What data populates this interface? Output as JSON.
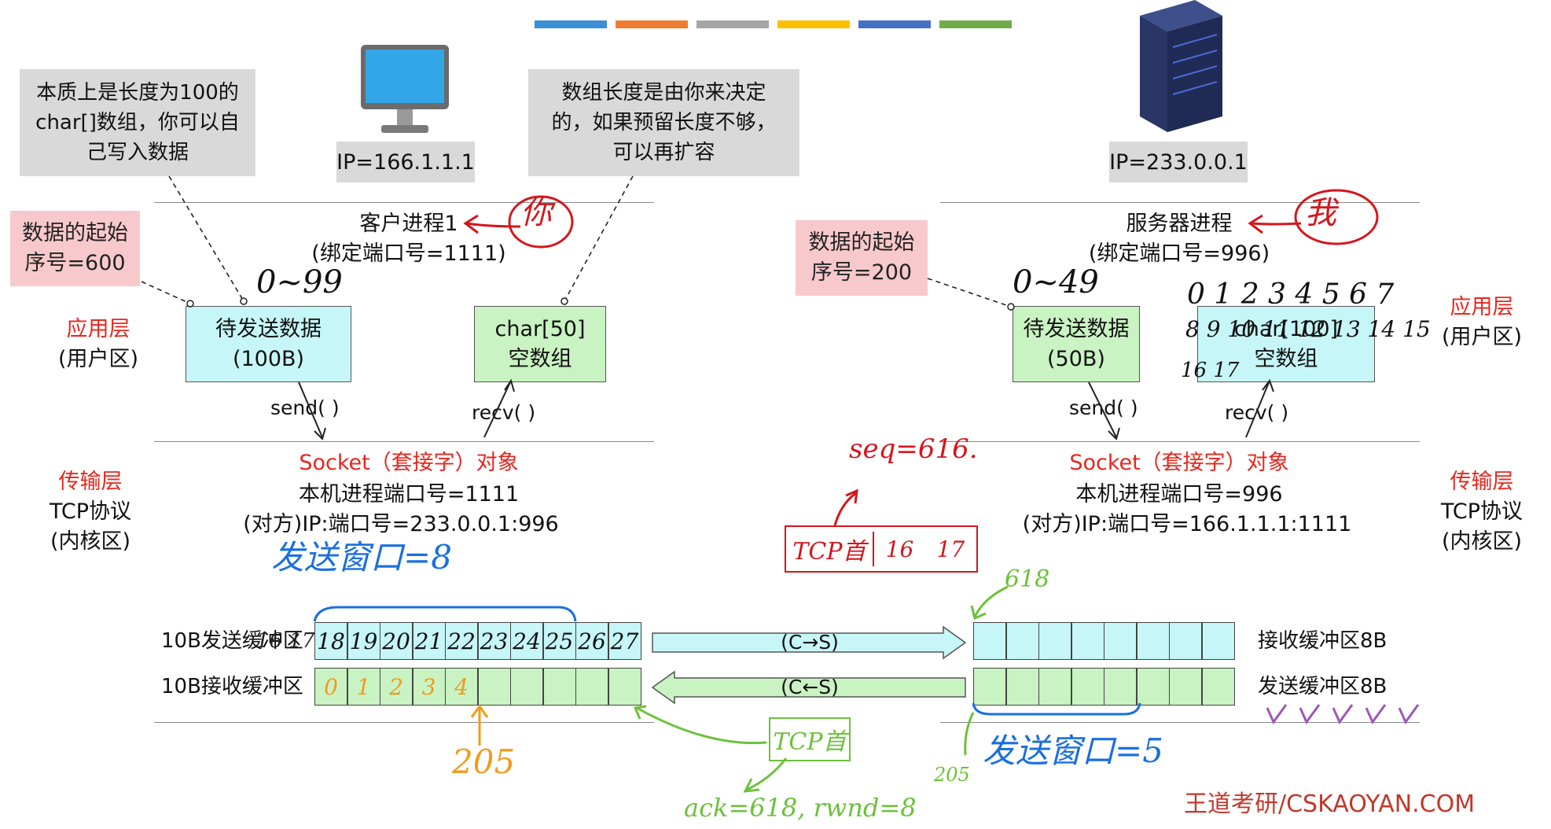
{
  "colors": {
    "red": "#e8261e",
    "blue": "#1a6fe0",
    "orange": "#f29b1e",
    "green": "#6cc23a",
    "cyan": "#c6f6f8",
    "lightgreen": "#c9f3c2",
    "pink": "#f8c9cc",
    "gray": "#d9d9d9"
  },
  "top_bar_colors": [
    "#3b8fd4",
    "#ef7d31",
    "#a5a5a5",
    "#ffc000",
    "#4472c4",
    "#70ad47"
  ],
  "client": {
    "note_left": "本质上是长度为100的\nchar[]数组，你可以自\n己写入数据",
    "note_right": "数组长度是由你来决定\n的，如果预留长度不够，\n可以再扩容",
    "ip": "IP=166.1.1.1",
    "process": "客户进程1",
    "port_bind": "(绑定端口号=1111)",
    "annot_you": "你",
    "start_seq": "数据的起始\n序号=600",
    "range": "0~99",
    "send_box": "待发送数据\n(100B)",
    "recv_box": "char[50]\n空数组",
    "send_fn": "send( )",
    "recv_fn": "recv( )",
    "socket": "Socket（套接字）对象",
    "local_port": "本机进程端口号=1111",
    "remote": "(对方)IP:端口号=233.0.0.1:996",
    "send_window": "发送窗口=8",
    "send_buf_label": "10B发送缓冲区",
    "recv_buf_label": "10B接收缓冲区",
    "send_cells": [
      "18",
      "19",
      "20",
      "21",
      "22",
      "23",
      "24",
      "25",
      "26",
      "27"
    ],
    "send_prefix": "16 17",
    "recv_cells": [
      "0",
      "1",
      "2",
      "3",
      "4",
      "",
      "",
      "",
      "",
      ""
    ],
    "ack_pos": "205"
  },
  "server": {
    "ip": "IP=233.0.0.1",
    "process": "服务器进程",
    "port_bind": "(绑定端口号=996)",
    "annot_me": "我",
    "start_seq": "数据的起始\n序号=200",
    "range": "0~49",
    "send_box": "待发送数据\n(50B)",
    "recv_box": "char[100]\n空数组",
    "recv_numbers_row1": "0 1 2 3 4 5 6 7",
    "recv_numbers_row2": "8 9 10 11 12 13 14 15",
    "recv_numbers_row3": "16 17",
    "send_fn": "send( )",
    "recv_fn": "recv( )",
    "socket": "Socket（套接字）对象",
    "local_port": "本机进程端口号=996",
    "remote": "(对方)IP:端口号=166.1.1.1:1111",
    "recv_buf_label": "接收缓冲区8B",
    "send_buf_label": "发送缓冲区8B",
    "send_window": "发送窗口=5",
    "recv_start": "618",
    "send_start": "205"
  },
  "layers": {
    "app_left": "应用层",
    "app_left_sub": "(用户区)",
    "app_right": "应用层",
    "app_right_sub": "(用户区)",
    "trans_left": "传输层",
    "trans_left_sub1": "TCP协议",
    "trans_left_sub2": "(内核区)",
    "trans_right": "传输层",
    "trans_right_sub1": "TCP协议",
    "trans_right_sub2": "(内核区)"
  },
  "arrows": {
    "c2s": "(C→S)",
    "s2c": "(C←S)"
  },
  "segment": {
    "seq": "seq=616.",
    "header": "TCP首",
    "data1": "16",
    "data2": "17"
  },
  "ack_segment": {
    "header": "TCP首",
    "text": "ack=618, rwnd=8"
  },
  "footer": "王道考研/CSKAOYAN.COM"
}
